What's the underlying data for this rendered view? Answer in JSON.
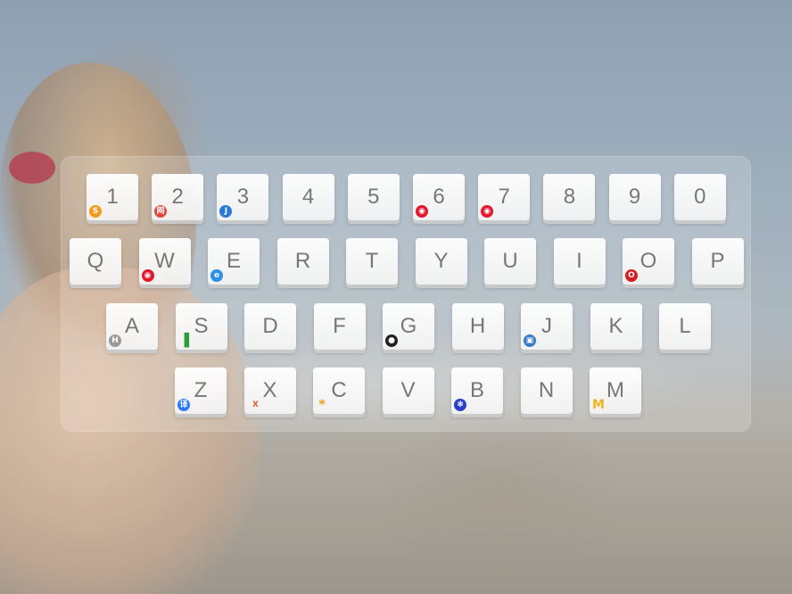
{
  "keyboard": {
    "rows": [
      [
        {
          "label": "1",
          "icon": "sogou-icon",
          "color": "#f29c1f"
        },
        {
          "label": "2",
          "icon": "netease-icon",
          "color": "#e0483c"
        },
        {
          "label": "3",
          "icon": "j-icon",
          "color": "#2a7ad5"
        },
        {
          "label": "4"
        },
        {
          "label": "5"
        },
        {
          "label": "6",
          "icon": "weibo-icon",
          "color": "#e6162d"
        },
        {
          "label": "7",
          "icon": "weibo-icon",
          "color": "#e6162d"
        },
        {
          "label": "8"
        },
        {
          "label": "9"
        },
        {
          "label": "0"
        }
      ],
      [
        {
          "label": "Q"
        },
        {
          "label": "W",
          "icon": "weibo-icon",
          "color": "#e6162d"
        },
        {
          "label": "E",
          "icon": "ie-icon",
          "color": "#2b8ee8"
        },
        {
          "label": "R"
        },
        {
          "label": "T"
        },
        {
          "label": "Y"
        },
        {
          "label": "U"
        },
        {
          "label": "I"
        },
        {
          "label": "O",
          "icon": "opera-icon",
          "color": "#d81b1b"
        },
        {
          "label": "P"
        }
      ],
      [
        {
          "label": "A",
          "icon": "h-script-icon",
          "color": "#999999"
        },
        {
          "label": "S",
          "icon": "signal-bars-icon",
          "color": "#2e9a3a"
        },
        {
          "label": "D"
        },
        {
          "label": "F"
        },
        {
          "label": "G",
          "icon": "github-icon",
          "color": "#222222"
        },
        {
          "label": "H"
        },
        {
          "label": "J",
          "icon": "car-icon",
          "color": "#3a78c9"
        },
        {
          "label": "K"
        },
        {
          "label": "L"
        }
      ],
      [
        {
          "label": "Z",
          "icon": "baidu-translate-icon",
          "color": "#2979ff"
        },
        {
          "label": "X",
          "icon": "xml-icon",
          "color": "#e65a2a"
        },
        {
          "label": "C",
          "icon": "asterisk-icon",
          "color": "#f39a1e"
        },
        {
          "label": "V"
        },
        {
          "label": "B",
          "icon": "baidu-paw-icon",
          "color": "#2a3ec9"
        },
        {
          "label": "N"
        },
        {
          "label": "M",
          "icon": "mcdonalds-icon",
          "color": "#f2b21a"
        }
      ]
    ]
  }
}
